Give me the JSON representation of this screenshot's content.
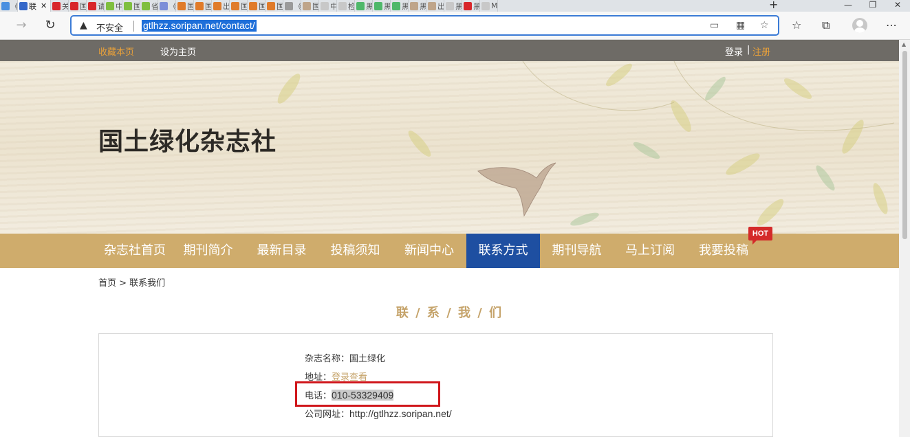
{
  "browser": {
    "tabs": [
      {
        "label": "《",
        "color": "#4a8fe0"
      },
      {
        "label": "联",
        "color": "#3568c9",
        "active": true
      },
      {
        "label": "关",
        "color": "#d8262a"
      },
      {
        "label": "国",
        "color": "#d8262a"
      },
      {
        "label": "请",
        "color": "#d8262a"
      },
      {
        "label": "中",
        "color": "#7fbf3f"
      },
      {
        "label": "国",
        "color": "#7fbf3f"
      },
      {
        "label": "省",
        "color": "#7fbf3f"
      },
      {
        "label": "《",
        "color": "#7b8ed8"
      },
      {
        "label": "国",
        "color": "#e07b2a"
      },
      {
        "label": "国",
        "color": "#e07b2a"
      },
      {
        "label": "出",
        "color": "#e07b2a"
      },
      {
        "label": "国",
        "color": "#e07b2a"
      },
      {
        "label": "国",
        "color": "#e07b2a"
      },
      {
        "label": "国",
        "color": "#e07b2a"
      },
      {
        "label": "《",
        "color": "#9a9a9a"
      },
      {
        "label": "国",
        "color": "#bfa58a"
      },
      {
        "label": "中",
        "color": "#c8c8c8"
      },
      {
        "label": "检",
        "color": "#c8c8c8"
      },
      {
        "label": "黑",
        "color": "#4fb86a"
      },
      {
        "label": "黑",
        "color": "#4fb86a"
      },
      {
        "label": "黑",
        "color": "#4fb86a"
      },
      {
        "label": "黑",
        "color": "#bfa58a"
      },
      {
        "label": "出",
        "color": "#bfa58a"
      },
      {
        "label": "黑",
        "color": "#c8c8c8"
      },
      {
        "label": "黑",
        "color": "#d8262a"
      },
      {
        "label": "M",
        "color": "#c8c8c8"
      }
    ],
    "close_tab_glyph": "✕",
    "new_tab_glyph": "+",
    "window_controls": [
      "—",
      "❐",
      "✕"
    ],
    "security_label": "不安全",
    "url": "gtlhzz.soripan.net/contact/"
  },
  "site": {
    "topbar": {
      "bookmark": "收藏本页",
      "set_home": "设为主页",
      "login": "登录",
      "divider": "|",
      "register": "注册"
    },
    "title": "国土绿化杂志社",
    "nav": [
      {
        "label": "杂志社首页"
      },
      {
        "label": "期刊简介"
      },
      {
        "label": "最新目录"
      },
      {
        "label": "投稿须知"
      },
      {
        "label": "新闻中心"
      },
      {
        "label": "联系方式",
        "active": true
      },
      {
        "label": "期刊导航"
      },
      {
        "label": "马上订阅"
      },
      {
        "label": "我要投稿"
      }
    ],
    "hot_badge": "HOT",
    "breadcrumb": "首页 > 联系我们",
    "section_title": "联 / 系 / 我 / 们",
    "contact": {
      "name_label": "杂志名称：",
      "name_value": "国土绿化",
      "address_label": "地址：",
      "address_value": "登录查看",
      "phone_label": "电话：",
      "phone_value": "010-53329409",
      "website_label": "公司网址：",
      "website_value": "http://gtlhzz.soripan.net/"
    }
  },
  "colors": {
    "accent_gold": "#c5a36a",
    "nav_bg": "#cfac6c",
    "nav_active": "#1e4fa1",
    "topbar_bg": "#6e6b66",
    "hot_red": "#d42a2a",
    "highlight_box": "#d0161b"
  }
}
